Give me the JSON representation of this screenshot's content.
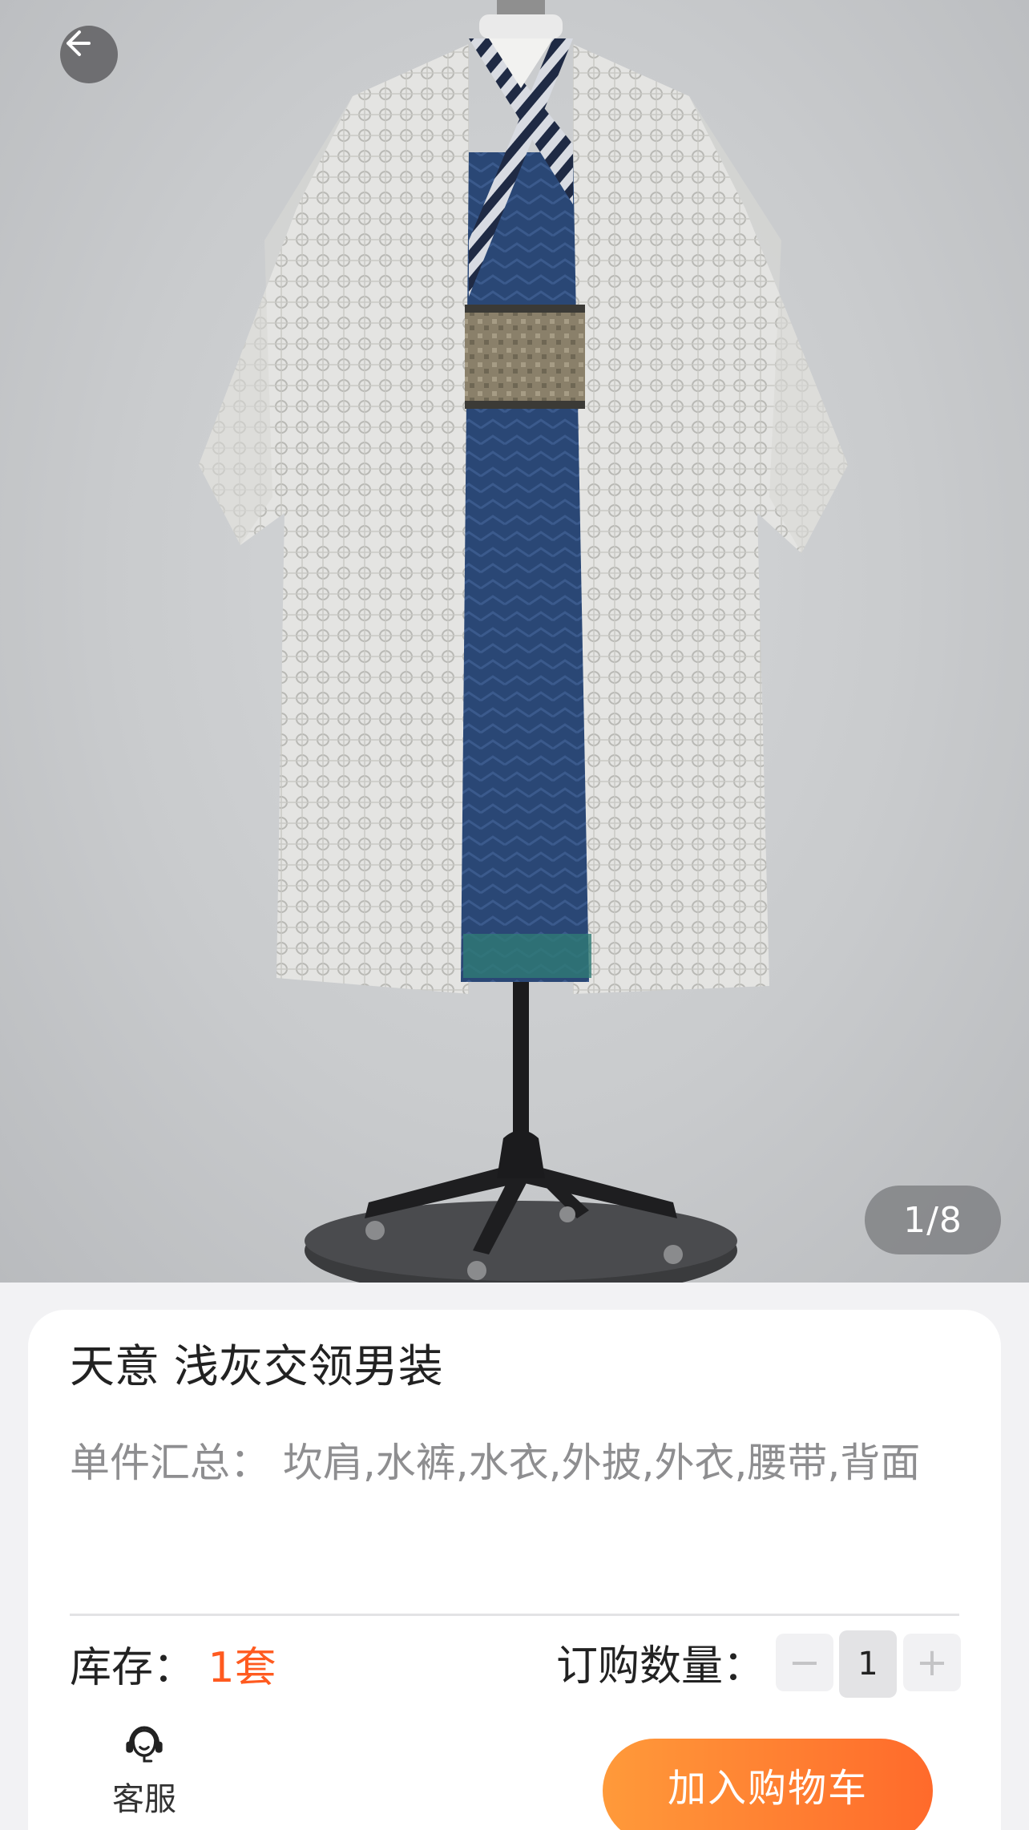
{
  "nav": {
    "back_icon": "arrow-left-icon"
  },
  "gallery": {
    "page_indicator": "1/8"
  },
  "product": {
    "title": "天意 浅灰交领男装",
    "summary_label": "单件汇总：",
    "summary_items": "坎肩,水裤,水衣,外披,外衣,腰带,背面",
    "stock_label": "库存：",
    "stock_value": "1套",
    "quantity_label": "订购数量：",
    "quantity_value": "1",
    "minus_symbol": "−",
    "plus_symbol": "+"
  },
  "bottom_bar": {
    "service_label": "客服",
    "service_icon": "headset-icon",
    "add_to_cart_label": "加入购物车"
  },
  "colors": {
    "accent": "#ff5a1f",
    "cart_gradient_start": "#ff9a3a",
    "cart_gradient_end": "#ff6a2b"
  }
}
